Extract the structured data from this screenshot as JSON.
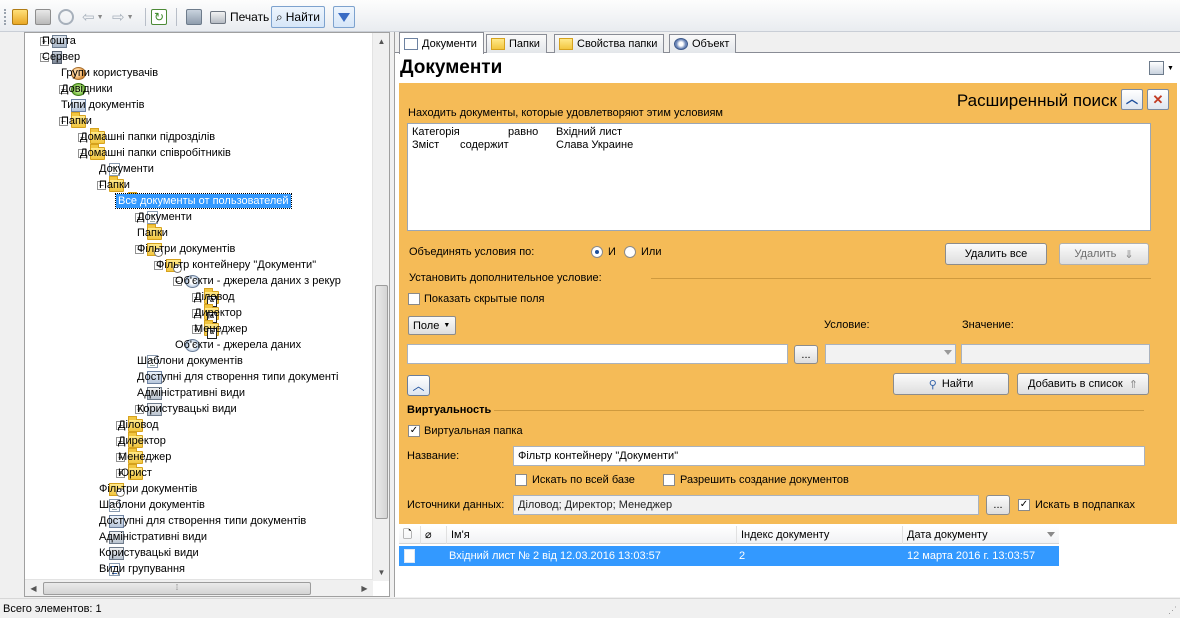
{
  "toolbar": {
    "print_label": "Печать",
    "find_label": "Найти"
  },
  "tree": {
    "items": [
      {
        "label": "Пошта",
        "icon": "mail-icon",
        "exp": "+"
      },
      {
        "label": "Сервер",
        "icon": "server-icon",
        "exp": "-"
      },
      {
        "label": "Групи користувачів",
        "icon": "users-icon",
        "exp": ""
      },
      {
        "label": "Довідники",
        "icon": "dictionary-icon",
        "exp": "+"
      },
      {
        "label": "Типи документів",
        "icon": "document-types-icon",
        "exp": ""
      },
      {
        "label": "Папки",
        "icon": "folder-icon",
        "exp": "-"
      },
      {
        "label": "Домашні папки підрозділів",
        "icon": "folder-icon",
        "exp": "+"
      },
      {
        "label": "Домашні папки співробітників",
        "icon": "folder-icon",
        "exp": "-"
      },
      {
        "label": "Документи",
        "icon": "document-icon",
        "exp": ""
      },
      {
        "label": "Папки",
        "icon": "folder-icon",
        "exp": "-"
      },
      {
        "label": "Все документы от пользователей",
        "icon": "folder-icon",
        "exp": "-",
        "selected": true
      },
      {
        "label": "Документи",
        "icon": "document-icon",
        "exp": "+"
      },
      {
        "label": "Папки",
        "icon": "folder-icon",
        "exp": ""
      },
      {
        "label": "Фільтри документів",
        "icon": "filter-icon",
        "exp": "-"
      },
      {
        "label": "Фільтр контейнеру \"Документи\"",
        "icon": "filter-icon",
        "exp": "-"
      },
      {
        "label": "Об'єкти - джерела даних з рекур",
        "icon": "data-source-icon",
        "exp": "-"
      },
      {
        "label": "Діловод",
        "icon": "linked-folder-icon",
        "exp": "+"
      },
      {
        "label": "Директор",
        "icon": "linked-folder-icon",
        "exp": "+"
      },
      {
        "label": "Менеджер",
        "icon": "linked-folder-icon",
        "exp": "+"
      },
      {
        "label": "Об'єкти - джерела даних",
        "icon": "data-source-icon",
        "exp": ""
      },
      {
        "label": "Шаблони документів",
        "icon": "document-icon",
        "exp": ""
      },
      {
        "label": "Доступні для створення типи документі",
        "icon": "document-types-icon",
        "exp": ""
      },
      {
        "label": "Адміністративні види",
        "icon": "view-icon",
        "exp": ""
      },
      {
        "label": "Користувацькі види",
        "icon": "view-icon",
        "exp": "+"
      },
      {
        "label": "Діловод",
        "icon": "folder-icon",
        "exp": "+"
      },
      {
        "label": "Директор",
        "icon": "folder-icon",
        "exp": "+"
      },
      {
        "label": "Менеджер",
        "icon": "folder-icon",
        "exp": "+"
      },
      {
        "label": "Юрист",
        "icon": "folder-icon",
        "exp": "+"
      },
      {
        "label": "Фільтри документів",
        "icon": "filter-icon",
        "exp": ""
      },
      {
        "label": "Шаблони документів",
        "icon": "document-icon",
        "exp": ""
      },
      {
        "label": "Доступні для створення типи документів",
        "icon": "document-types-icon",
        "exp": ""
      },
      {
        "label": "Адміністративні види",
        "icon": "view-icon",
        "exp": ""
      },
      {
        "label": "Користувацькі види",
        "icon": "view-icon",
        "exp": ""
      },
      {
        "label": "Види групування",
        "icon": "grouping-icon",
        "exp": ""
      }
    ]
  },
  "tabs": [
    {
      "label": "Документи",
      "active": true
    },
    {
      "label": "Папки"
    },
    {
      "label": "Свойства папки"
    },
    {
      "label": "Объект"
    }
  ],
  "doc_title": "Документи",
  "search": {
    "title": "Расширенный поиск",
    "conditions_label": "Находить документы, которые удовлетворяют этим условиям",
    "conditions": [
      {
        "field": "Категорія",
        "op": "равно",
        "value": "Вхідний лист"
      },
      {
        "field": "Зміст",
        "op": "содержит",
        "value": "Слава Украине"
      }
    ],
    "combine_label": "Объединять условия по:",
    "radio_and": "И",
    "radio_or": "Или",
    "delete_all_label": "Удалить все",
    "delete_label": "Удалить",
    "add_condition_label": "Установить дополнительное условие:",
    "show_hidden_label": "Показать скрытые поля",
    "field_dropdown": "Поле",
    "condition_label": "Условие:",
    "value_label": "Значение:",
    "browse_label": "...",
    "find_label": "Найти",
    "add_to_list_label": "Добавить в список",
    "virtuality_label": "Виртуальность",
    "virtual_folder_label": "Виртуальная папка",
    "name_label": "Название:",
    "name_value": "Фільтр контейнеру \"Документи\"",
    "search_all_label": "Искать по всей базе",
    "allow_create_label": "Разрешить создание документов",
    "sources_label": "Источники данных:",
    "sources_value": "Діловод; Директор; Менеджер",
    "search_subfolders_label": "Искать в подпапках"
  },
  "grid": {
    "columns": [
      "Ім'я",
      "Індекс документу",
      "Дата документу"
    ],
    "rows": [
      {
        "name": "Вхідний лист № 2 від 12.03.2016 13:03:57",
        "index": "2",
        "date": "12 марта 2016 г. 13:03:57"
      }
    ]
  },
  "status": {
    "text": "Всего элементов: 1"
  },
  "colors": {
    "search_bg": "#f5bb57",
    "selection": "#3399ff"
  }
}
